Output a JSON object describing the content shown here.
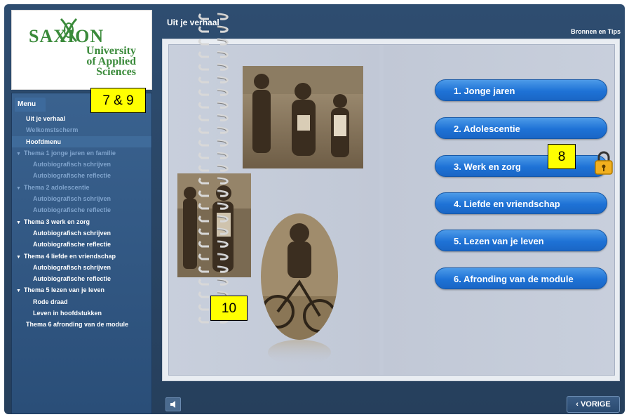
{
  "logo": {
    "name": "SAXION",
    "lines": [
      "University",
      "of Applied",
      "Sciences"
    ]
  },
  "sidebar": {
    "menu_tab": "Menu",
    "items": [
      {
        "label": "Uit je verhaal",
        "kind": "top",
        "state": "active"
      },
      {
        "label": "Welkomstscherm",
        "kind": "top",
        "state": "dim"
      },
      {
        "label": "Hoofdmenu",
        "kind": "top",
        "state": "highlight"
      },
      {
        "label": "Thema 1 jonge jaren en familie",
        "kind": "theme",
        "state": "dim"
      },
      {
        "label": "Autobiografisch schrijven",
        "kind": "sub",
        "state": "dim"
      },
      {
        "label": "Autobiografische reflectie",
        "kind": "sub",
        "state": "dim"
      },
      {
        "label": "Thema 2 adolescentie",
        "kind": "theme",
        "state": "dim"
      },
      {
        "label": "Autobiografisch schrijven",
        "kind": "sub",
        "state": "dim"
      },
      {
        "label": "Autobiografische reflectie",
        "kind": "sub",
        "state": "dim"
      },
      {
        "label": "Thema 3 werk en zorg",
        "kind": "theme",
        "state": "active"
      },
      {
        "label": "Autobiografisch schrijven",
        "kind": "sub",
        "state": "active"
      },
      {
        "label": "Autobiografische reflectie",
        "kind": "sub",
        "state": "active"
      },
      {
        "label": "Thema 4 liefde en vriendschap",
        "kind": "theme",
        "state": "active"
      },
      {
        "label": "Autobiografisch schrijven",
        "kind": "sub",
        "state": "active"
      },
      {
        "label": "Autobiografische reflectie",
        "kind": "sub",
        "state": "active"
      },
      {
        "label": "Thema 5 lezen van je leven",
        "kind": "theme",
        "state": "active"
      },
      {
        "label": "Rode draad",
        "kind": "sub",
        "state": "active"
      },
      {
        "label": "Leven in hoofdstukken",
        "kind": "sub",
        "state": "active"
      },
      {
        "label": "Thema 6 afronding van de module",
        "kind": "top",
        "state": "active"
      }
    ]
  },
  "header": {
    "title": "Uit je verhaal",
    "bronnen": "Bronnen en Tips"
  },
  "chapters": [
    {
      "label": "1. Jonge jaren",
      "locked": false
    },
    {
      "label": "2. Adolescentie",
      "locked": false
    },
    {
      "label": "3. Werk en zorg",
      "locked": true
    },
    {
      "label": "4. Liefde en vriendschap",
      "locked": false
    },
    {
      "label": "5. Lezen van je leven",
      "locked": false
    },
    {
      "label": "6. Afronding van de module",
      "locked": false
    }
  ],
  "notes": {
    "n1": "7 & 9",
    "n2": "8",
    "n3": "10"
  },
  "footer": {
    "vorige": "VORIGE",
    "vorige_icon": "chevron-left-icon",
    "speaker_icon": "speaker-icon"
  },
  "colors": {
    "frame": "#2b4a6b",
    "sidebar": "#2f5480",
    "chapter_button": "#1e72d6",
    "note": "#ffff00",
    "logo_green": "#3a8a3a"
  }
}
